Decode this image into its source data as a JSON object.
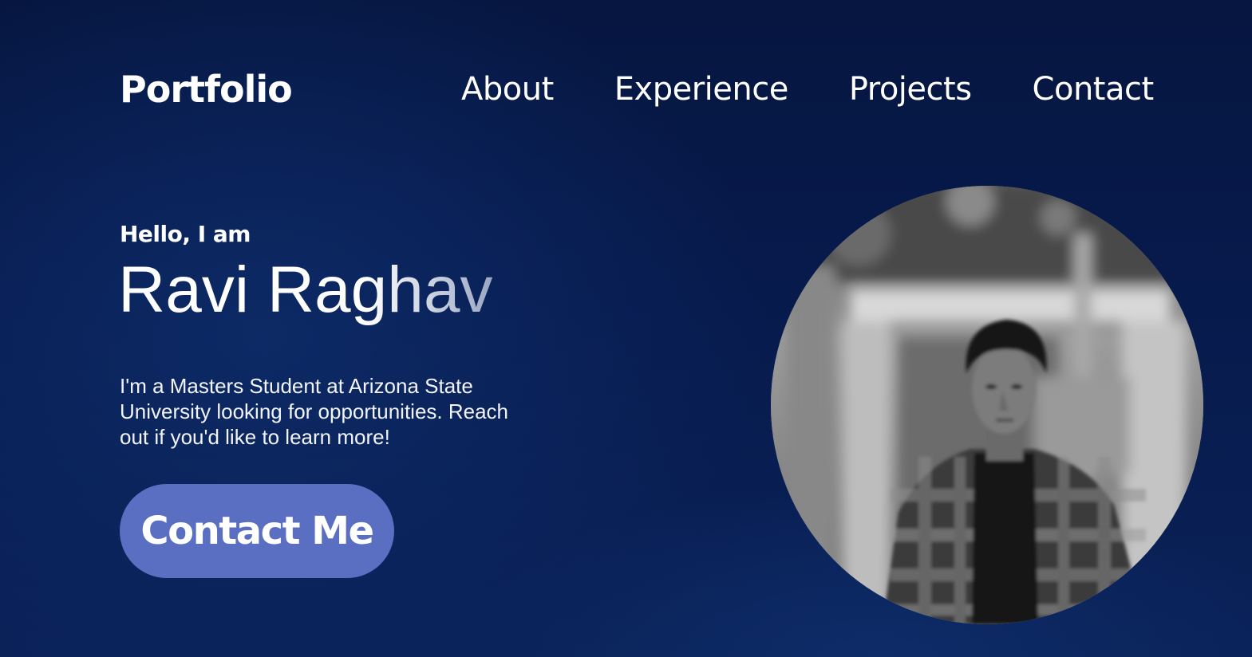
{
  "header": {
    "logo": "Portfolio",
    "nav": [
      "About",
      "Experience",
      "Projects",
      "Contact"
    ]
  },
  "hero": {
    "greeting": "Hello, I am",
    "name": "Ravi Raghav",
    "bio": "I'm a Masters Student at Arizona State University looking for opportunities. Reach out if you'd like to learn more!",
    "cta_label": "Contact Me"
  },
  "colors": {
    "background": "#071a4c",
    "button": "#5b6fc2",
    "text": "#ffffff"
  }
}
